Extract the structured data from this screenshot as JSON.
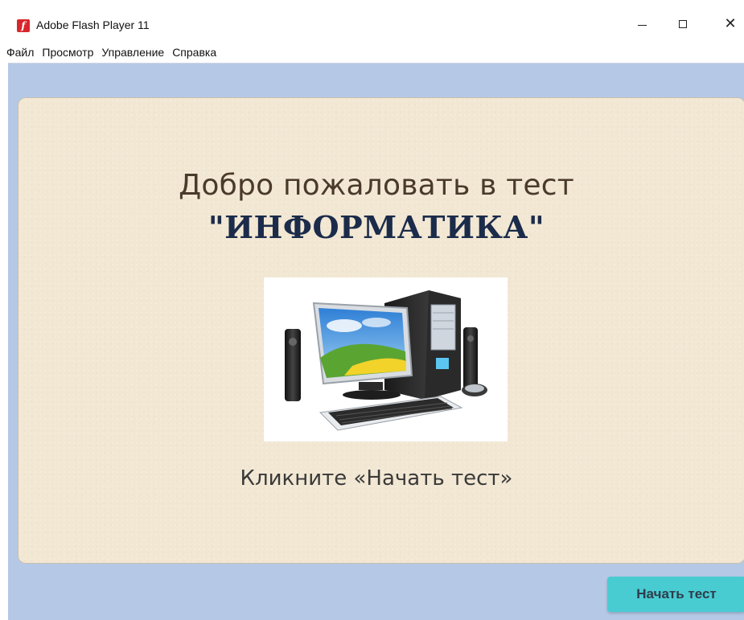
{
  "window": {
    "title": "Adobe Flash Player 11",
    "icon": "adobe-flash-icon",
    "controls": {
      "minimize": "minimize-icon",
      "maximize": "maximize-icon",
      "close": "close-icon",
      "close_glyph": "✕"
    }
  },
  "menu": {
    "items": [
      {
        "label": "Файл"
      },
      {
        "label": "Просмотр"
      },
      {
        "label": "Управление"
      },
      {
        "label": "Справка"
      }
    ]
  },
  "content": {
    "welcome_text": "Добро пожаловать в тест",
    "subject_text": "\"ИНФОРМАТИКА\"",
    "image": "desktop-computer-illustration",
    "instruction_text": "Кликните «Начать тест»"
  },
  "footer": {
    "start_button_label": "Начать тест"
  },
  "colors": {
    "stage_background": "#b5c8e6",
    "card_background": "#f2e7d3",
    "start_button": "#49cbd2",
    "subject_text": "#1b2b4a"
  }
}
